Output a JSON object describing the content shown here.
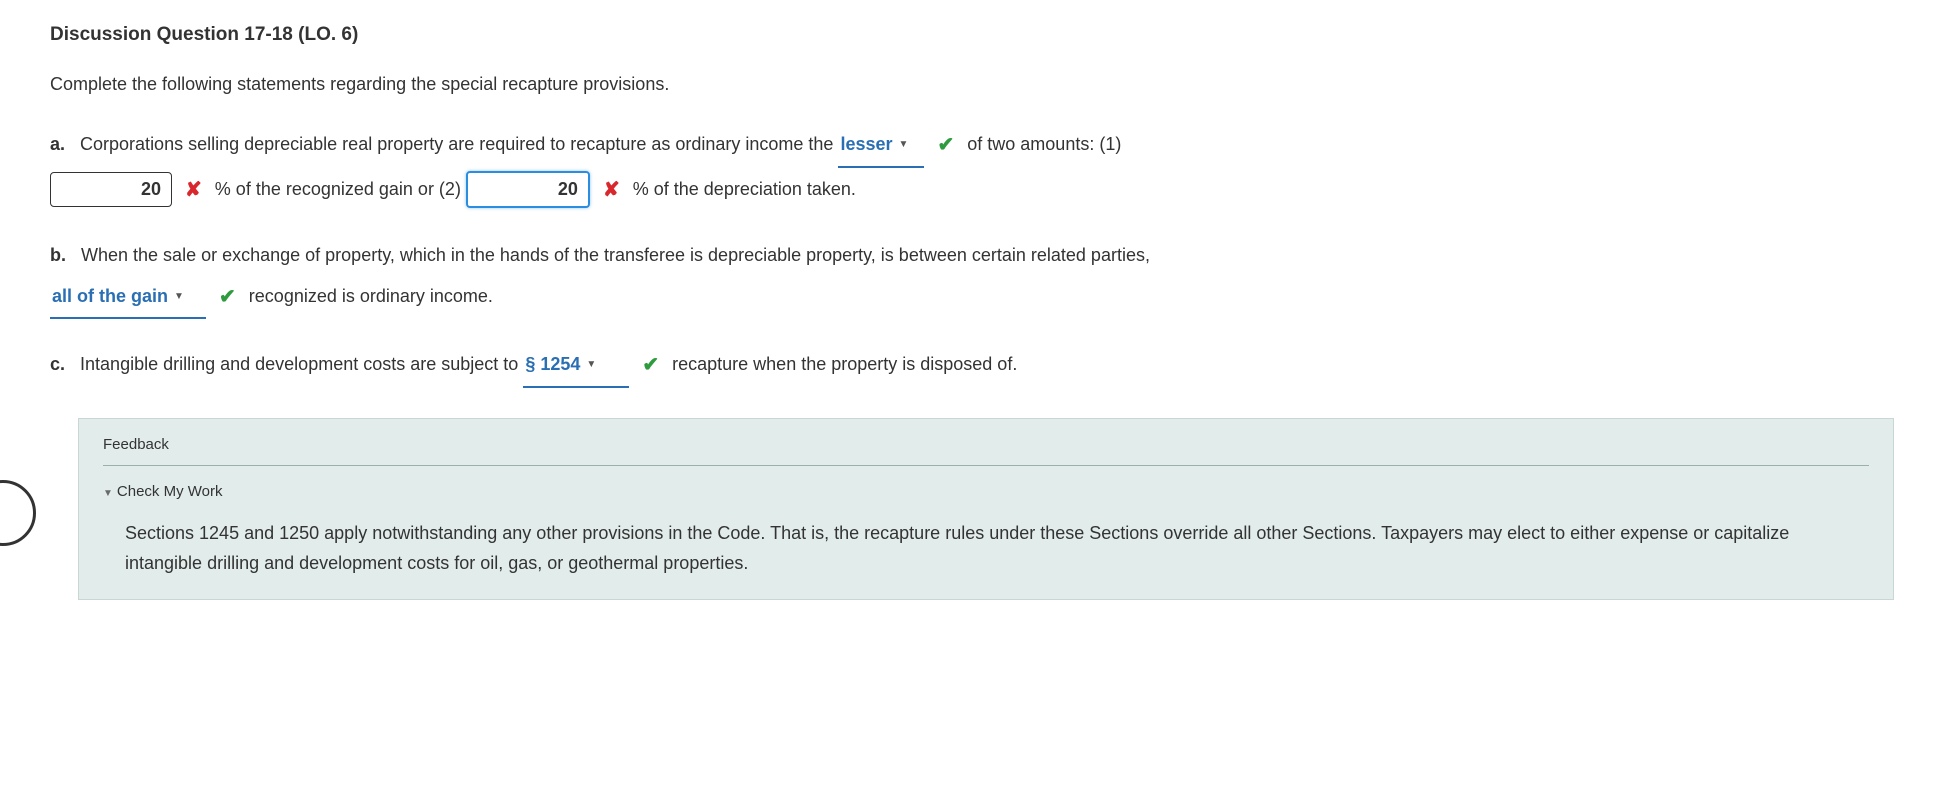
{
  "title": "Discussion Question 17-18 (LO. 6)",
  "intro": "Complete the following statements regarding the special recapture provisions.",
  "a": {
    "label": "a.",
    "text1": "Corporations selling depreciable real property are required to recapture as ordinary income the",
    "dropdown1": "lesser",
    "text2": "of two amounts: (1)",
    "input1": "20",
    "text3": "% of the recognized gain or (2)",
    "input2": "20",
    "text4": "% of the depreciation taken."
  },
  "b": {
    "label": "b.",
    "text1": "When the sale or exchange of property, which in the hands of the transferee is depreciable property, is between certain related parties,",
    "dropdown1": "all of the gain",
    "text2": "recognized is ordinary income."
  },
  "c": {
    "label": "c.",
    "text1": "Intangible drilling and development costs are subject to",
    "dropdown1": "§ 1254",
    "text2": "recapture when the property is disposed of."
  },
  "feedback": {
    "title": "Feedback",
    "check_label": "Check My Work",
    "text": "Sections 1245 and 1250 apply notwithstanding any other provisions in the Code. That is, the recapture rules under these Sections override all other Sections. Taxpayers may elect to either expense or capitalize intangible drilling and development costs for oil, gas, or geothermal properties."
  },
  "icons": {
    "check": "✔",
    "x": "✘",
    "caret": "▼",
    "tri": "▼"
  }
}
